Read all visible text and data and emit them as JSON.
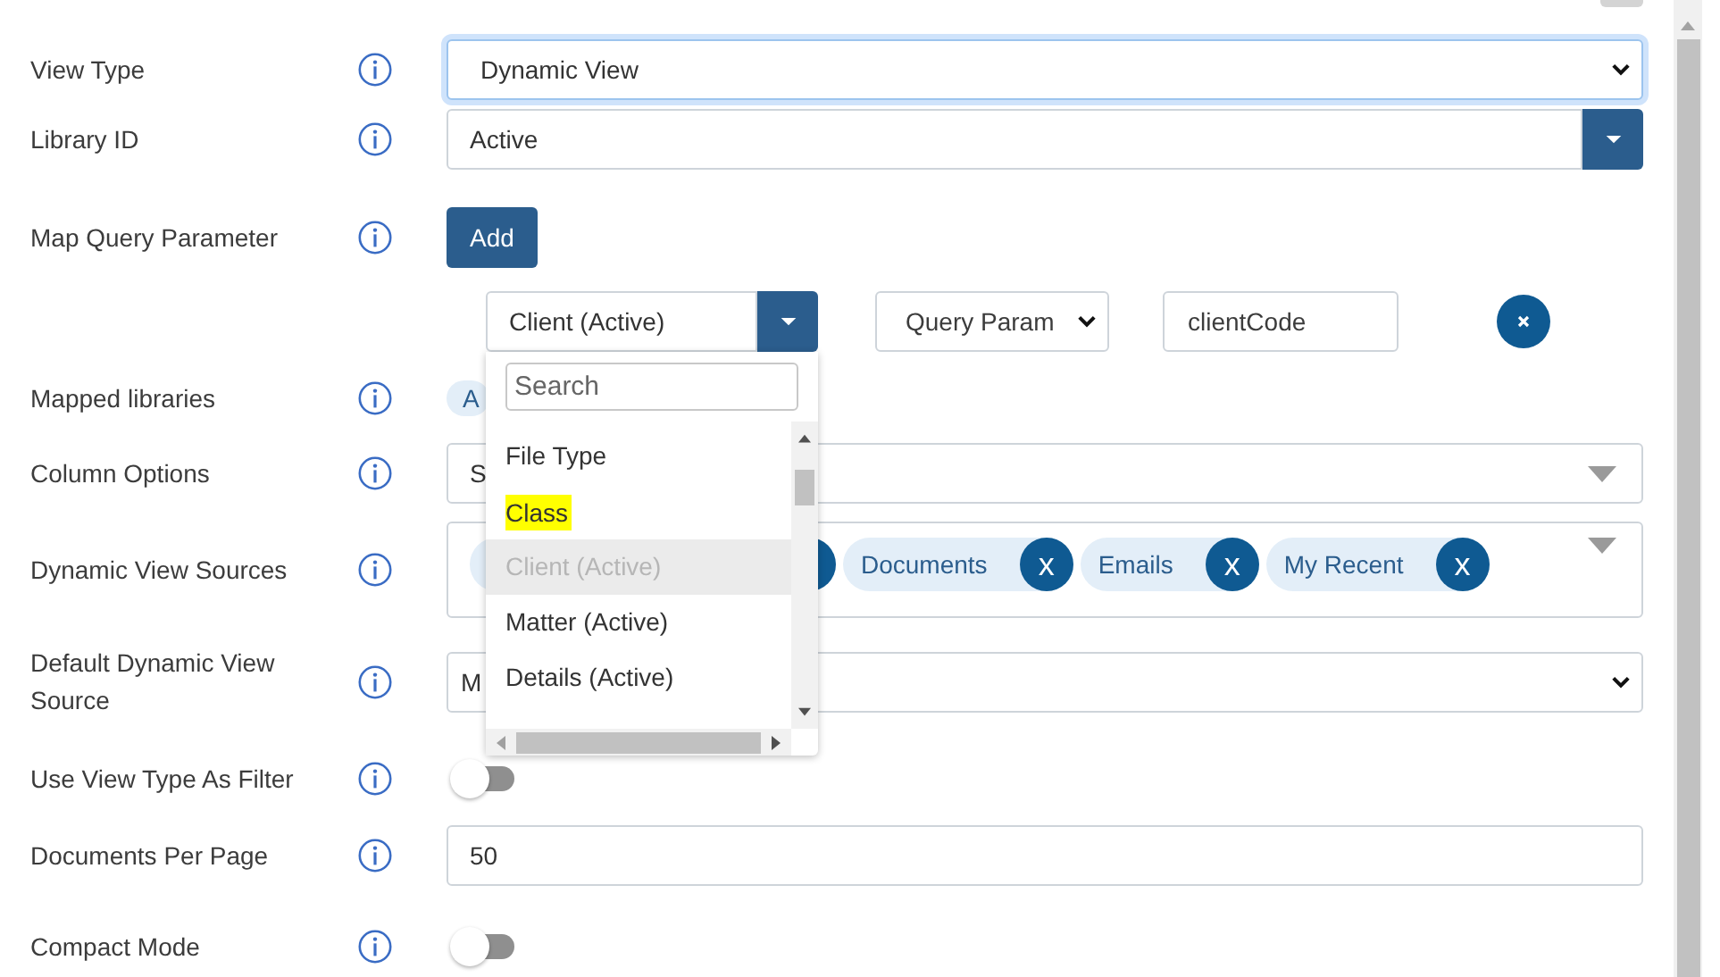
{
  "fields": [
    {
      "kind": "select",
      "label": "View Type",
      "value": "Dynamic View",
      "focused": true
    },
    {
      "kind": "combo",
      "label": "Library ID",
      "value": "Active"
    },
    {
      "kind": "button",
      "label": "Map Query Parameter",
      "button": "Add"
    },
    {
      "kind": "mapping",
      "source": "Client (Active)",
      "param_type": "Query Param",
      "param_value": "clientCode",
      "dropdown": {
        "placeholder": "Search",
        "options": [
          {
            "label": "File Type",
            "selected": false,
            "highlighted": false
          },
          {
            "label": "Class",
            "selected": false,
            "highlighted": true
          },
          {
            "label": "Client (Active)",
            "selected": true,
            "highlighted": false
          },
          {
            "label": "Matter (Active)",
            "selected": false,
            "highlighted": false
          },
          {
            "label": "Details (Active)",
            "selected": false,
            "highlighted": false
          }
        ]
      }
    },
    {
      "kind": "chips",
      "label": "Mapped libraries",
      "chips": [
        {
          "label": "A"
        }
      ]
    },
    {
      "kind": "multiselect",
      "label": "Column Options",
      "value": "S"
    },
    {
      "kind": "chipbox",
      "label": "Dynamic View Sources",
      "chips": [
        {
          "label": "Documents",
          "remove": "x"
        },
        {
          "label": "Emails",
          "remove": "x"
        },
        {
          "label": "My Recent",
          "remove": "x"
        }
      ]
    },
    {
      "kind": "select",
      "label": "Default Dynamic View Source",
      "value": "M",
      "focused": false
    },
    {
      "kind": "toggle",
      "label": "Use View Type As Filter",
      "on": false
    },
    {
      "kind": "input",
      "label": "Documents Per Page",
      "value": "50"
    },
    {
      "kind": "toggle",
      "label": "Compact Mode",
      "on": false
    }
  ]
}
